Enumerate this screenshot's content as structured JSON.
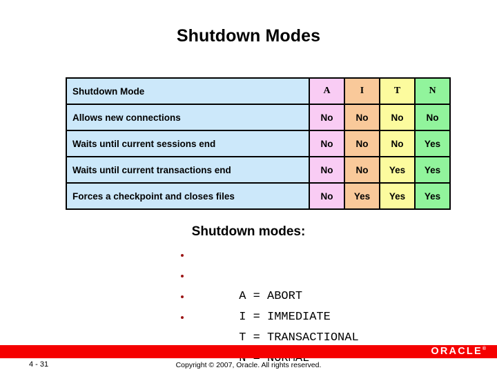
{
  "slide": {
    "title": "Shutdown Modes"
  },
  "table": {
    "header": {
      "label": "Shutdown Mode",
      "columns": [
        "A",
        "I",
        "T",
        "N"
      ]
    },
    "rows": [
      {
        "label": "Allows new connections",
        "values": [
          "No",
          "No",
          "No",
          "No"
        ]
      },
      {
        "label": "Waits until current sessions end",
        "values": [
          "No",
          "No",
          "No",
          "Yes"
        ]
      },
      {
        "label": "Waits until current transactions end",
        "values": [
          "No",
          "No",
          "Yes",
          "Yes"
        ]
      },
      {
        "label": "Forces a checkpoint and closes files",
        "values": [
          "No",
          "Yes",
          "Yes",
          "Yes"
        ]
      }
    ],
    "colors": {
      "label": "#cce8fa",
      "a": "#f9ccf4",
      "i": "#f9c99a",
      "t": "#fcfb9e",
      "n": "#91f49c",
      "border": "#000000"
    }
  },
  "modes": {
    "heading": "Shutdown modes:",
    "items": [
      "A = ABORT",
      "I = IMMEDIATE",
      "T = TRANSACTIONAL",
      "N = NORMAL"
    ],
    "bullet_color": "#9c1616"
  },
  "footer": {
    "bar_color": "#f50000",
    "logo": "ORACLE",
    "logo_tm": "®",
    "page_number": "4 - 31",
    "copyright": "Copyright © 2007, Oracle. All rights reserved."
  }
}
